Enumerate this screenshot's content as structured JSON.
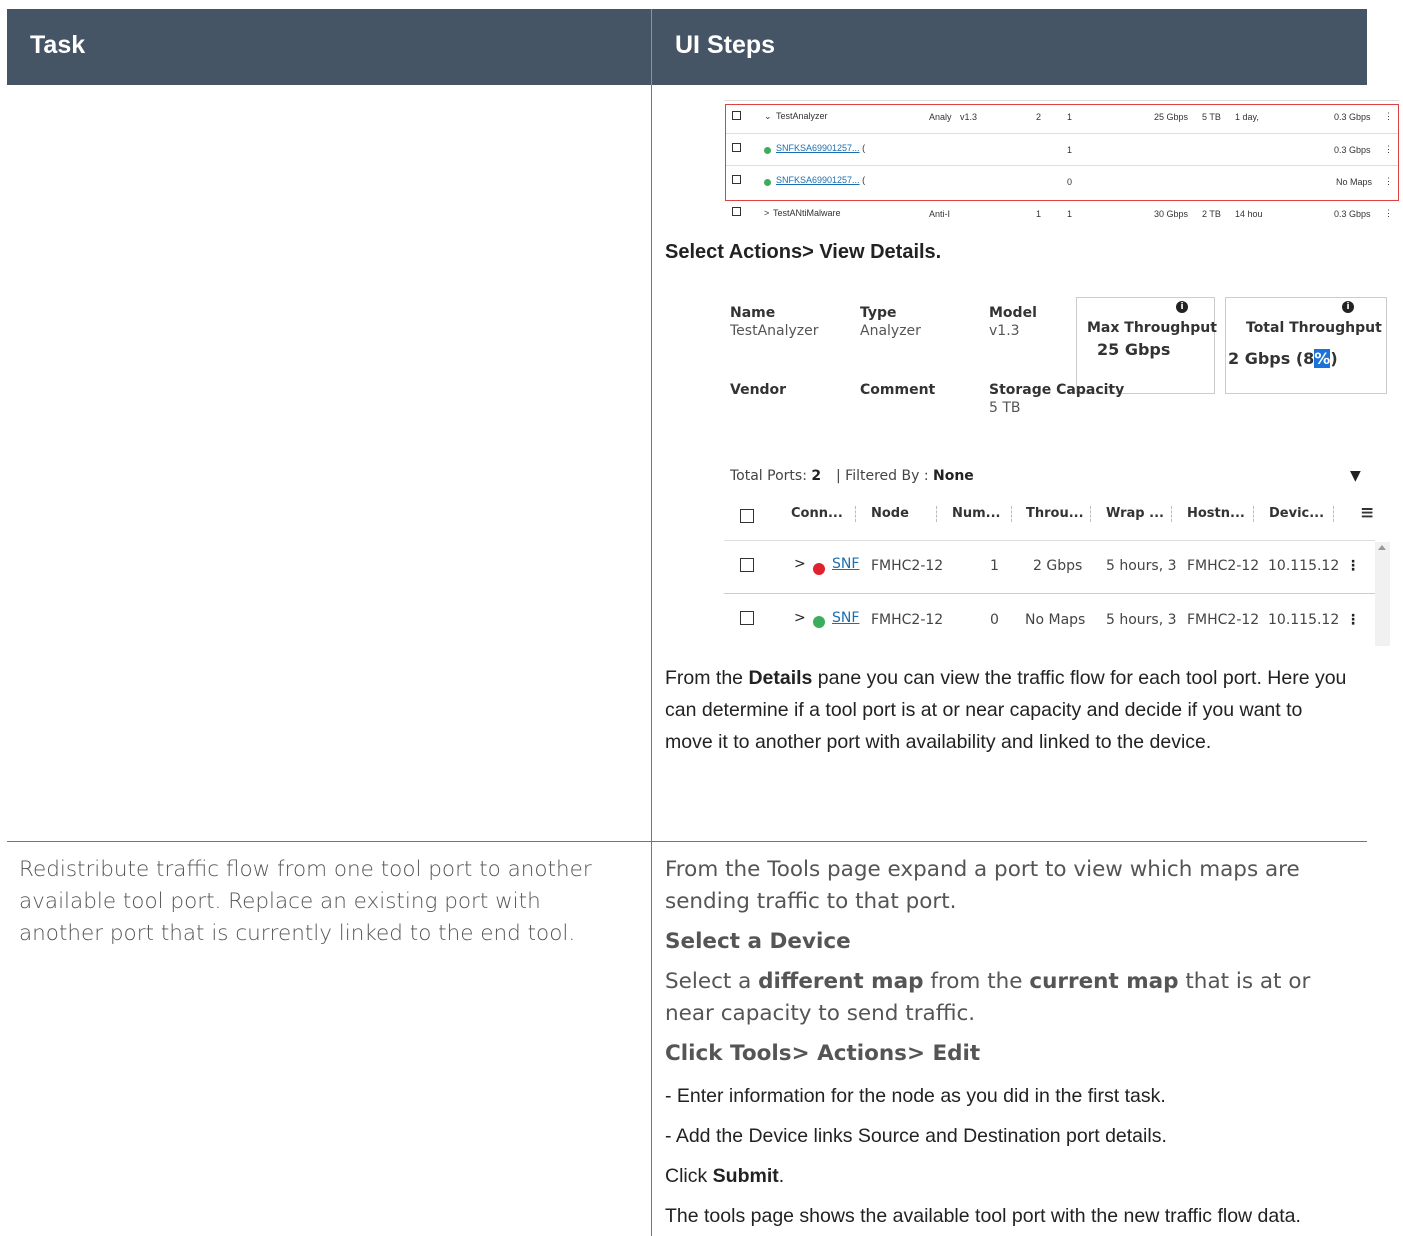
{
  "header": {
    "task": "Task",
    "steps": "UI Steps"
  },
  "mini_list": {
    "rows": [
      {
        "expander": "⌄",
        "name": "TestAnalyzer",
        "type": "Analy",
        "model": "v1.3",
        "c1": "2",
        "c2": "1",
        "max": "25 Gbps",
        "storage": "5 TB",
        "time": "1 day,",
        "total": "0.3 Gbps"
      },
      {
        "link": "SNFKSA69901257...",
        "suffix": "(",
        "c2": "1",
        "total": "0.3 Gbps"
      },
      {
        "link": "SNFKSA69901257...",
        "suffix": "(",
        "c2": "0",
        "total": "No Maps"
      },
      {
        "expander": ">",
        "name": "TestANtiMalware",
        "type": "Anti-I",
        "c1": "1",
        "c2": "1",
        "max": "30 Gbps",
        "storage": "2 TB",
        "time": "14 hou",
        "total": "0.3 Gbps"
      }
    ],
    "menu": "⋮"
  },
  "select_actions": "Select Actions> View Details.",
  "details": {
    "name_label": "Name",
    "name_value": "TestAnalyzer",
    "type_label": "Type",
    "type_value": "Analyzer",
    "model_label": "Model",
    "model_value": "v1.3",
    "vendor_label": "Vendor",
    "comment_label": "Comment",
    "storage_label": "Storage Capacity",
    "storage_value": "5 TB",
    "max_card": {
      "title": "Max Throughput",
      "value": "25 Gbps",
      "info": "i"
    },
    "total_card": {
      "title": "Total Throughput",
      "value_pre": "2 Gbps (8",
      "value_hl": "%",
      "value_post": ")",
      "info": "i"
    },
    "total_ports_label": "Total Ports:",
    "total_ports_value": "2",
    "filtered_label": "| Filtered By :",
    "filtered_value": "None",
    "filter_icon": "▼",
    "columns": [
      "Conn...",
      "Node",
      "Num...",
      "Throu...",
      "Wrap ...",
      "Hostn...",
      "Devic..."
    ],
    "columns_menu": "≡",
    "rows": [
      {
        "expander": ">",
        "status_color": "#e0212f",
        "conn": "SNF",
        "node": "FMHC2-12",
        "num": "1",
        "throughput": "2 Gbps",
        "wrap": "5 hours, 3",
        "host": "FMHC2-12",
        "device": "10.115.12",
        "menu": "⋮"
      },
      {
        "expander": ">",
        "status_color": "#3cae5b",
        "conn": "SNF",
        "node": "FMHC2-12",
        "num": "0",
        "throughput": "No Maps",
        "wrap": "5 hours, 3",
        "host": "FMHC2-12",
        "device": "10.115.12",
        "menu": "⋮"
      }
    ]
  },
  "paragraph1": {
    "pre": "From the ",
    "bold": "Details",
    "post": " pane you can view the traffic flow for each tool port. Here you can determine if a tool port is at or near capacity and decide if you want to move it to another port with availability and linked to the device."
  },
  "task2": "Redistribute traffic flow from one tool port to another available tool port. Replace an existing port with another port that is currently linked to the end tool.",
  "steps2": {
    "line1": "From the Tools page expand a port to view which maps are sending traffic to that port.",
    "line2": "Select a Device",
    "line3_pre": "Select a ",
    "line3_b1": "different map",
    "line3_mid": " from the ",
    "line3_b2": "current map",
    "line3_post": " that is at or near capacity to send traffic.",
    "line4": "Click Tools> Actions> Edit",
    "line5": "- Enter information for the node as you did in the first task.",
    "line6": "- Add the Device links Source and Destination port details.",
    "line7_pre": "Click ",
    "line7_b": "Submit",
    "line7_post": ".",
    "line8": "The tools page shows the available tool port with the new traffic flow data."
  }
}
